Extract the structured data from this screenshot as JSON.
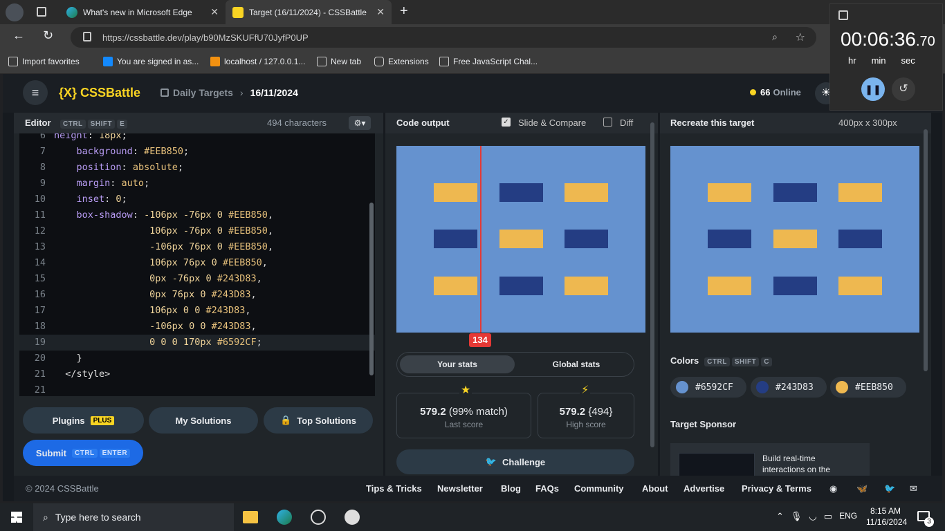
{
  "browser": {
    "tabs": [
      {
        "title": "What's new in Microsoft Edge"
      },
      {
        "title": "Target (16/11/2024) - CSSBattle"
      }
    ],
    "url": "https://cssbattle.dev/play/b90MzSKUFfU70JyfP0UP",
    "favorites": [
      "Import favorites",
      "You are signed in as...",
      "localhost / 127.0.0.1...",
      "New tab",
      "Extensions",
      "Free JavaScript Chal..."
    ]
  },
  "timer": {
    "time": "00:06:36",
    "fraction": ".70",
    "units": [
      "hr",
      "min",
      "sec"
    ]
  },
  "header": {
    "logo": "{X} CSSBattle",
    "breadcrumb_1": "Daily Targets",
    "breadcrumb_2": "16/11/2024",
    "online": "66",
    "online_label": "Online"
  },
  "editor": {
    "title": "Editor",
    "shortcut": [
      "CTRL",
      "SHIFT",
      "E"
    ],
    "chars": "494 characters",
    "lines": [
      {
        "n": "6",
        "text": "    height: 18px;"
      },
      {
        "n": "7",
        "text": ""
      },
      {
        "n": "8",
        "text": ""
      },
      {
        "n": "9",
        "text": ""
      },
      {
        "n": "10",
        "text": ""
      },
      {
        "n": "11",
        "text": ""
      },
      {
        "n": "12",
        "text": ""
      },
      {
        "n": "13",
        "text": ""
      },
      {
        "n": "14",
        "text": ""
      },
      {
        "n": "15",
        "text": ""
      },
      {
        "n": "16",
        "text": ""
      },
      {
        "n": "17",
        "text": ""
      },
      {
        "n": "18",
        "text": ""
      },
      {
        "n": "19",
        "text": ""
      },
      {
        "n": "20",
        "text": ""
      },
      {
        "n": "21",
        "text": ""
      }
    ],
    "buttons": {
      "plugins": "Plugins",
      "plus": "PLUS",
      "my_solutions": "My Solutions",
      "top_solutions": "Top Solutions",
      "submit": "Submit",
      "submit_keys": [
        "CTRL",
        "ENTER"
      ]
    }
  },
  "output": {
    "title": "Code output",
    "slide_compare": "Slide & Compare",
    "diff": "Diff",
    "slider_value": "134",
    "tabs": [
      "Your stats",
      "Global stats"
    ],
    "score_value": "579.2",
    "score_match": "(99% match)",
    "score_label": "Last score",
    "high_value": "579.2",
    "high_chars": "{494}",
    "high_label": "High score",
    "challenge": "Challenge"
  },
  "target": {
    "title": "Recreate this target",
    "size": "400px x 300px",
    "colors_label": "Colors",
    "colors_keys": [
      "CTRL",
      "SHIFT",
      "C"
    ],
    "colors": [
      {
        "hex": "#6592CF"
      },
      {
        "hex": "#243D83"
      },
      {
        "hex": "#EEB850"
      }
    ],
    "sponsor_label": "Target Sponsor",
    "sponsor_text": "Build real-time interactions on the"
  },
  "footer": {
    "copyright": "© 2024 CSSBattle",
    "links": [
      "Tips & Tricks",
      "Newsletter",
      "Blog",
      "FAQs",
      "Community",
      "About",
      "Advertise",
      "Privacy & Terms"
    ]
  },
  "taskbar": {
    "search": "Type here to search",
    "lang": "ENG",
    "time": "8:15 AM",
    "date": "11/16/2024",
    "notifications": "3"
  }
}
